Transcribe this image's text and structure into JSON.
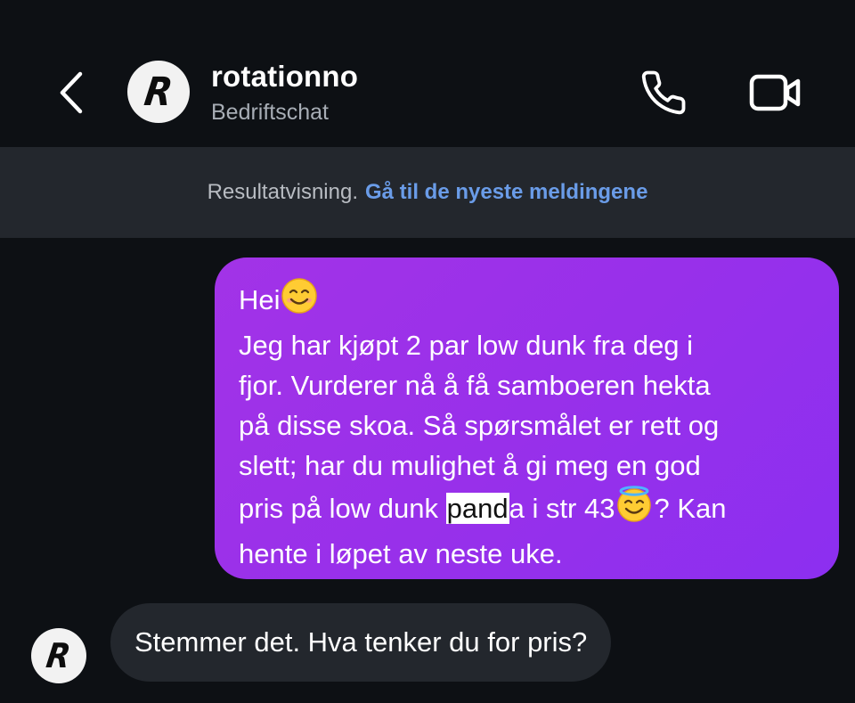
{
  "header": {
    "username": "rotationno",
    "subtitle": "Bedriftschat",
    "avatar_letter": "R",
    "back_icon": "chevron-left-icon",
    "call_icon": "phone-icon",
    "video_icon": "video-camera-icon"
  },
  "banner": {
    "status_text": "Resultatvisning.",
    "link_text": "Gå til de nyeste meldingene"
  },
  "messages": {
    "outgoing": {
      "greeting": "Hei",
      "greeting_emoji": "smiling-face-icon",
      "body_before_highlight": "Jeg har kjøpt 2 par low dunk fra deg i\nfjor. Vurderer nå å få samboeren hekta\npå disse skoa. Så spørsmålet er rett og\nslett; har du mulighet å gi meg en god\npris på low dunk ",
      "highlight": "pand",
      "body_after_highlight": "a i str 43",
      "angel_emoji": "halo-face-icon",
      "body_end": "? Kan\nhente i løpet av neste uke."
    },
    "incoming": {
      "avatar_letter": "R",
      "text": "Stemmer det. Hva tenker du for pris?"
    }
  },
  "colors": {
    "background": "#0d1014",
    "banner_bg": "#23272d",
    "link": "#6a9ce8",
    "outgoing_bubble": "#9830ea",
    "incoming_bubble": "#23272d"
  }
}
